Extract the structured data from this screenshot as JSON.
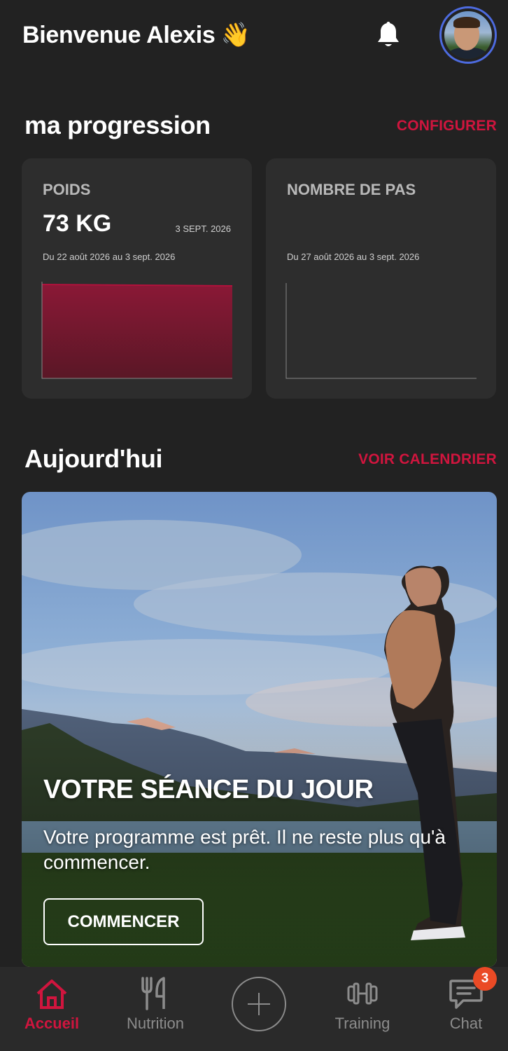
{
  "header": {
    "greeting": "Bienvenue Alexis",
    "wave_emoji": "👋"
  },
  "progression": {
    "title": "ma progression",
    "action": "CONFIGURER",
    "cards": [
      {
        "title": "POIDS",
        "value": "73 KG",
        "date": "3 SEPT. 2026",
        "range": "Du 22 août 2026 au 3 sept. 2026",
        "fill_color": "#8a1836"
      },
      {
        "title": "NOMBRE DE PAS",
        "value": "",
        "date": "",
        "range": "Du 27 août 2026 au 3 sept. 2026"
      }
    ]
  },
  "today": {
    "title": "Aujourd'hui",
    "action": "VOIR CALENDRIER",
    "session_title": "VOTRE SÉANCE DU JOUR",
    "session_text": "Votre programme est prêt. Il ne reste plus qu'à commencer.",
    "start_button": "COMMENCER"
  },
  "nav": {
    "items": [
      {
        "label": "Accueil",
        "icon": "home-icon",
        "active": true
      },
      {
        "label": "Nutrition",
        "icon": "fork-knife-icon",
        "active": false
      },
      {
        "label": "",
        "icon": "plus-icon",
        "active": false
      },
      {
        "label": "Training",
        "icon": "dumbbell-icon",
        "active": false
      },
      {
        "label": "Chat",
        "icon": "chat-icon",
        "active": false
      }
    ],
    "chat_badge": "3"
  },
  "colors": {
    "accent": "#d0153e",
    "background": "#222222",
    "card": "#2d2d2d",
    "avatar_ring": "#4d6be0",
    "badge": "#ea4a25"
  }
}
